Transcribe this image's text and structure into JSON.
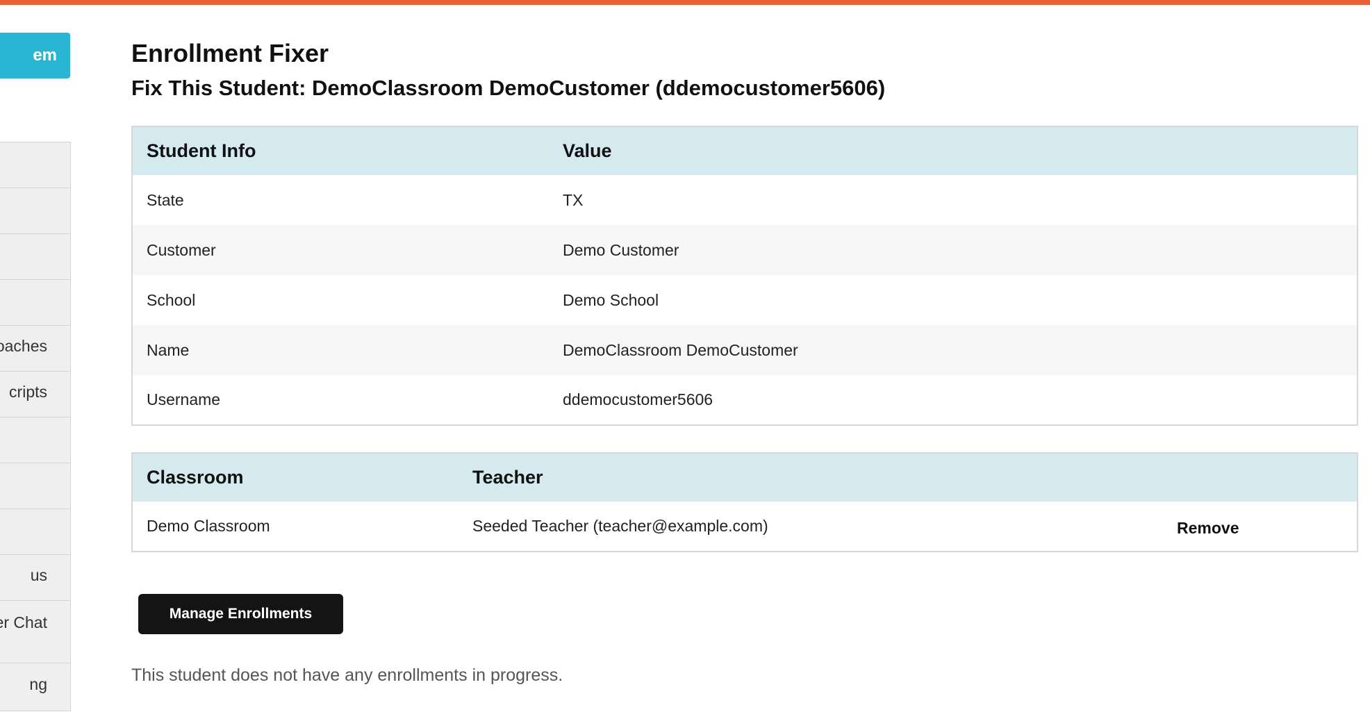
{
  "colors": {
    "top_bar": "#ee5f36",
    "sidebar_button": "#29b6d2",
    "table_header": "#d5eaee",
    "primary_button": "#141414"
  },
  "sidebar": {
    "cta_label": "em",
    "items": [
      {
        "label": ""
      },
      {
        "label": ""
      },
      {
        "label": ""
      },
      {
        "label": ""
      },
      {
        "label": "oaches"
      },
      {
        "label": "cripts"
      },
      {
        "label": ""
      },
      {
        "label": ""
      },
      {
        "label": ""
      },
      {
        "label": "us"
      },
      {
        "label": "er Chat"
      },
      {
        "label": "ng"
      }
    ]
  },
  "page": {
    "title": "Enrollment Fixer",
    "subtitle": "Fix This Student: DemoClassroom DemoCustomer (ddemocustomer5606)"
  },
  "student_table": {
    "headers": [
      "Student Info",
      "Value"
    ],
    "rows": [
      {
        "field": "State",
        "value": "TX"
      },
      {
        "field": "Customer",
        "value": "Demo Customer"
      },
      {
        "field": "School",
        "value": "Demo School"
      },
      {
        "field": "Name",
        "value": "DemoClassroom DemoCustomer"
      },
      {
        "field": "Username",
        "value": "ddemocustomer5606"
      }
    ]
  },
  "enrollment_table": {
    "headers": [
      "Classroom",
      "Teacher"
    ],
    "rows": [
      {
        "classroom": "Demo Classroom",
        "teacher": "Seeded Teacher (teacher@example.com)",
        "action": "Remove"
      }
    ]
  },
  "manage_button_label": "Manage Enrollments",
  "status_message": "This student does not have any enrollments in progress."
}
